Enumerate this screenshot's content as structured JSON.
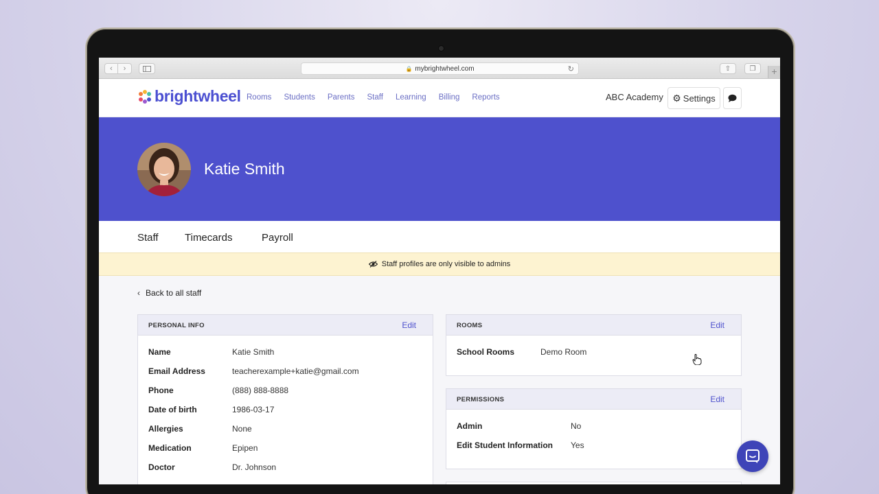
{
  "browser": {
    "url": "mybrightwheel.com",
    "back_icon": "chevron-left-icon",
    "forward_icon": "chevron-right-icon"
  },
  "header": {
    "logo_text": "brightwheel",
    "nav": [
      "Rooms",
      "Students",
      "Parents",
      "Staff",
      "Learning",
      "Billing",
      "Reports"
    ],
    "school_name": "ABC Academy",
    "settings_label": "Settings"
  },
  "profile": {
    "name": "Katie Smith"
  },
  "tabs": [
    "Staff",
    "Timecards",
    "Payroll"
  ],
  "notice": {
    "text": "Staff profiles are only visible to admins"
  },
  "back_link": "Back to all staff",
  "personal_info": {
    "title": "PERSONAL INFO",
    "edit_label": "Edit",
    "fields": [
      {
        "label": "Name",
        "value": "Katie Smith"
      },
      {
        "label": "Email Address",
        "value": "teacherexample+katie@gmail.com"
      },
      {
        "label": "Phone",
        "value": "(888) 888-8888"
      },
      {
        "label": "Date of birth",
        "value": "1986-03-17"
      },
      {
        "label": "Allergies",
        "value": "None"
      },
      {
        "label": "Medication",
        "value": "Epipen"
      },
      {
        "label": "Doctor",
        "value": "Dr. Johnson"
      }
    ]
  },
  "rooms": {
    "title": "ROOMS",
    "edit_label": "Edit",
    "label": "School Rooms",
    "value": "Demo Room"
  },
  "permissions": {
    "title": "PERMISSIONS",
    "edit_label": "Edit",
    "fields": [
      {
        "label": "Admin",
        "value": "No"
      },
      {
        "label": "Edit Student Information",
        "value": "Yes"
      }
    ]
  },
  "colors": {
    "brand": "#4e51cd",
    "notice_bg": "#fdf3d1"
  }
}
